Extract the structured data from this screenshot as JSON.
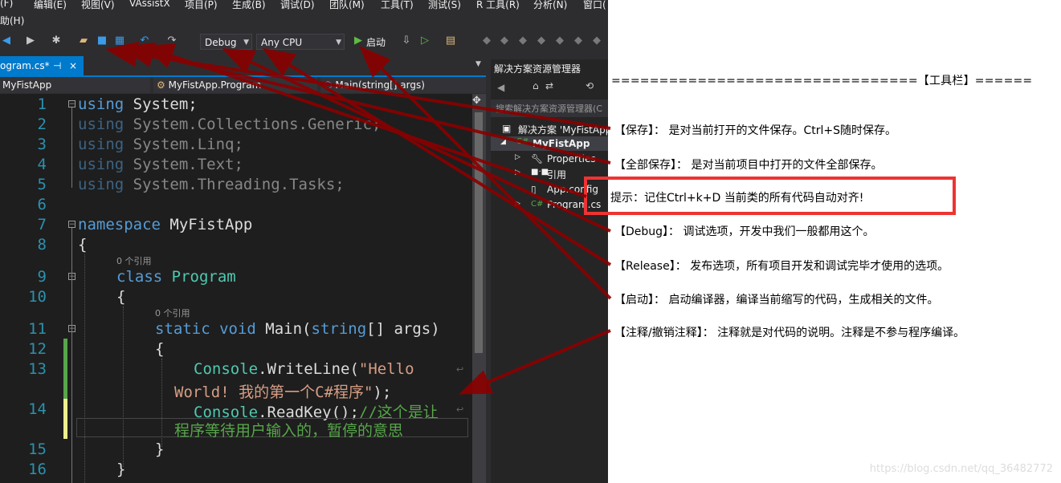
{
  "menu": [
    "(F)",
    "编辑(E)",
    "视图(V)",
    "VAssistX",
    "项目(P)",
    "生成(B)",
    "调试(D)",
    "团队(M)",
    "工具(T)",
    "测试(S)",
    "R 工具(R)",
    "分析(N)",
    "窗口("
  ],
  "menu_row2": "助(H)",
  "toolbar": {
    "config": "Debug",
    "platform": "Any CPU",
    "start_label": "启动"
  },
  "tab": {
    "filename": "ogram.cs*",
    "pin": "⊣",
    "close": "×"
  },
  "navbar": {
    "project": "MyFistApp",
    "class": "MyFistApp.Program",
    "member": "Main(string[] args)"
  },
  "editor": {
    "line_numbers": [
      "1",
      "2",
      "3",
      "4",
      "5",
      "6",
      "7",
      "8",
      "9",
      "10",
      "11",
      "12",
      "13",
      "14",
      "15",
      "16"
    ],
    "ref_hint_class": "0 个引用",
    "ref_hint_main": "0 个引用"
  },
  "solution": {
    "title": "解决方案资源管理器",
    "search": "搜索解决方案资源管理器(C",
    "items": [
      "解决方案 'MyFistApp'",
      "MyFistApp",
      "Properties",
      "引用",
      "App.config",
      "Program.cs"
    ]
  },
  "notes": {
    "header": "================================【工具栏】======",
    "save": "【保存】： 是对当前打开的文件保存。Ctrl+S随时保存。",
    "save_all": "【全部保存】： 是对当前项目中打开的文件全部保存。",
    "tip": "提示：记住Ctrl+k+D  当前类的所有代码自动对齐!",
    "debug": "【Debug】： 调试选项，开发中我们一般都用这个。",
    "release": "【Release】： 发布选项，所有项目开发和调试完毕才使用的选项。",
    "start": "【启动】： 启动编译器，编译当前缩写的代码，生成相关的文件。",
    "comment": "【注释/撤销注释】： 注释就是对代码的说明。注释是不参与程序编译。"
  },
  "watermark": "https://blog.csdn.net/qq_36482772",
  "colors": {
    "accent": "#007acc",
    "keyword": "#569cd6",
    "type": "#4ec9b0",
    "string": "#d69d85",
    "comment": "#57a64a",
    "arrow": "#8b0000",
    "tip_border": "#ee3333"
  }
}
